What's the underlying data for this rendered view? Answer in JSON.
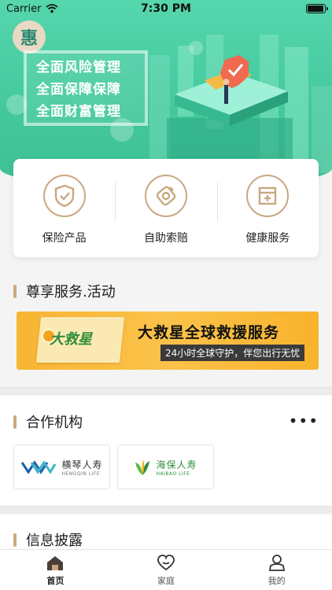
{
  "status_bar": {
    "carrier": "Carrier",
    "time": "7:30 PM",
    "battery_level": 0.85
  },
  "banner": {
    "badge_text": "惠",
    "slogans": [
      "全面风险管理",
      "全面保障保障",
      "全面财富管理"
    ],
    "colors": {
      "primary": "#43c89c",
      "accent": "#c9a880"
    }
  },
  "services": [
    {
      "label": "保险产品",
      "icon": "shield-check-icon"
    },
    {
      "label": "自助索赔",
      "icon": "claim-tag-icon"
    },
    {
      "label": "健康服务",
      "icon": "medical-box-icon"
    }
  ],
  "exclusive": {
    "title": "尊享服务.活动",
    "promo": {
      "logo_text": "大救星",
      "title": "大救星全球救援服务",
      "subtitle": "24小时全球守护，伴您出行无忧"
    }
  },
  "partners": {
    "title": "合作机构",
    "more_icon": "more-dots-icon",
    "items": [
      {
        "name_cn": "横琴人寿",
        "name_en": "HENGQIN LIFE"
      },
      {
        "name_cn": "海保人寿",
        "name_en": "HAIBAO LIFE"
      }
    ]
  },
  "disclosure": {
    "title": "信息披露"
  },
  "tabs": [
    {
      "label": "首页",
      "icon": "home-icon",
      "active": true
    },
    {
      "label": "家庭",
      "icon": "family-heart-icon",
      "active": false
    },
    {
      "label": "我的",
      "icon": "user-icon",
      "active": false
    }
  ]
}
